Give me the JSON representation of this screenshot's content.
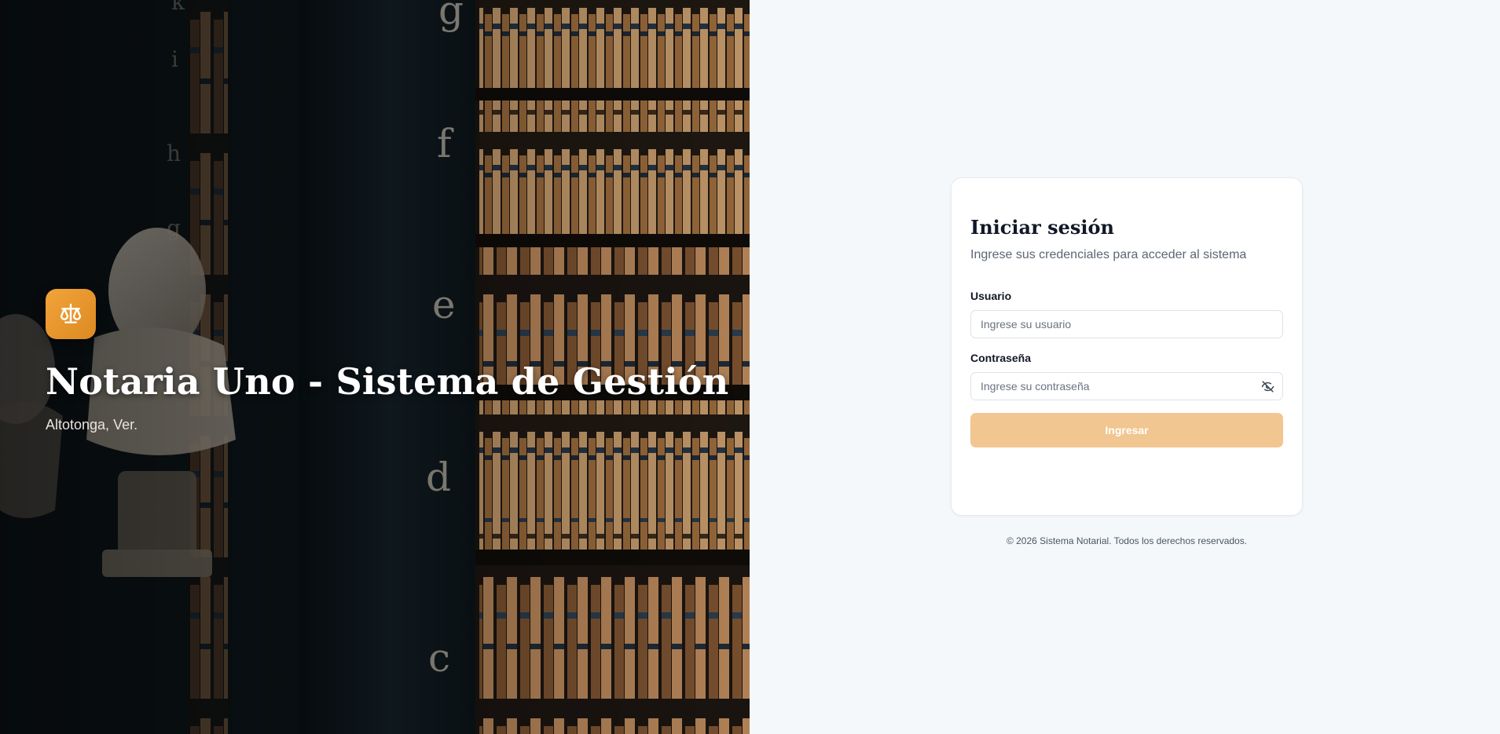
{
  "hero": {
    "title": "Notaria Uno - Sistema de Gestión",
    "subtitle": "Altotonga, Ver.",
    "logo_icon": "scales-of-justice-icon",
    "logo_color": "#e8962e"
  },
  "login": {
    "title": "Iniciar sesión",
    "description": "Ingrese sus credenciales para acceder al sistema",
    "username": {
      "label": "Usuario",
      "placeholder": "Ingrese su usuario",
      "value": ""
    },
    "password": {
      "label": "Contraseña",
      "placeholder": "Ingrese su contraseña",
      "value": "",
      "toggle_icon": "eye-off-icon"
    },
    "submit_label": "Ingresar",
    "accent_color": "#f1c690"
  },
  "footer": {
    "text": "© 2026 Sistema Notarial. Todos los derechos reservados."
  },
  "colors": {
    "page_background": "#f5f8fb",
    "card_background": "#ffffff",
    "text_primary": "#111827"
  }
}
